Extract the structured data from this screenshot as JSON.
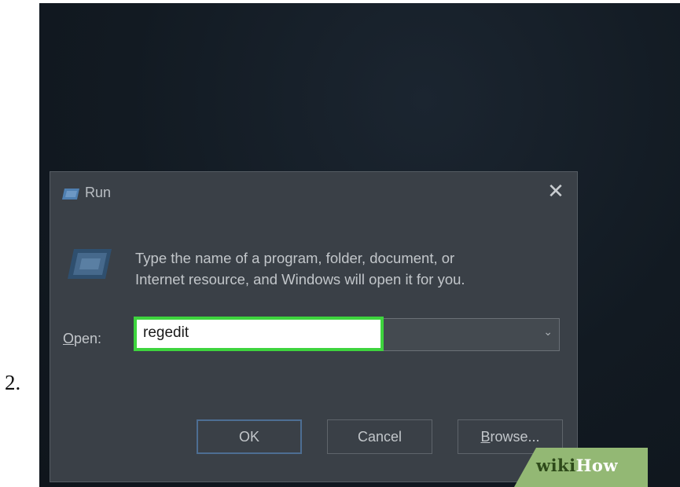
{
  "step": {
    "number": "2."
  },
  "dialog": {
    "title": "Run",
    "close_glyph": "✕",
    "description_line1": "Type the name of a program, folder, document, or",
    "description_line2": "Internet resource, and Windows will open it for you.",
    "open_label": "Open:",
    "open_value": "regedit",
    "ok_label": "OK",
    "cancel_label": "Cancel",
    "browse_label": "Browse..."
  },
  "watermark": {
    "wiki": "wiki",
    "how": "How"
  },
  "colors": {
    "highlight": "#3ed43e",
    "dialog_bg": "#3a4047",
    "ok_border": "#4d6e93"
  },
  "icons": [
    "run-icon",
    "close-icon",
    "run-large-icon",
    "chevron-down-icon"
  ]
}
